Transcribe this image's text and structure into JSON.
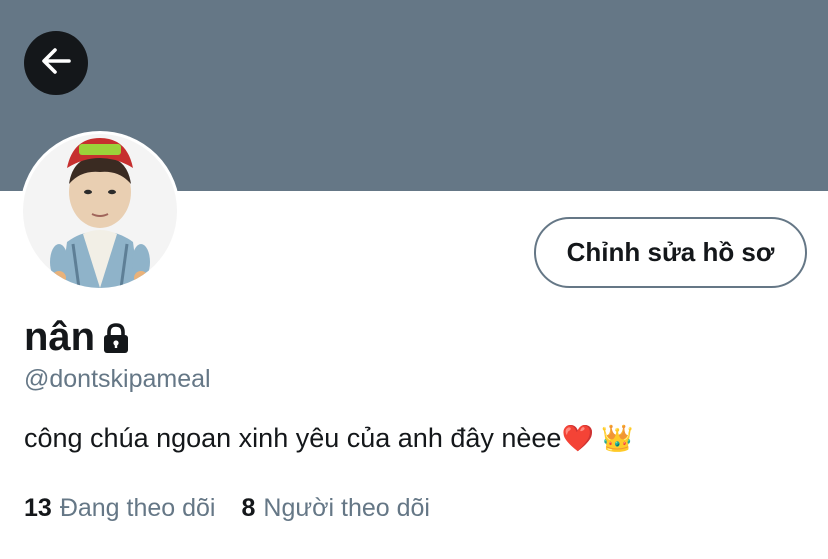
{
  "profile": {
    "display_name": "nân",
    "handle": "@dontskipameal",
    "bio": "công chúa ngoan xinh yêu của anh đây nèee",
    "bio_emojis": "❤️ 👑",
    "protected_icon": "lock-icon",
    "edit_button_label": "Chỉnh sửa hồ sơ"
  },
  "stats": {
    "following_count": "13",
    "following_label": "Đang theo dõi",
    "followers_count": "8",
    "followers_label": "Người theo dõi"
  },
  "nav": {
    "back_icon": "back-arrow-icon"
  },
  "colors": {
    "banner": "#657786",
    "text_primary": "#14171a",
    "text_secondary": "#657786",
    "back_button_bg": "#14171a"
  }
}
